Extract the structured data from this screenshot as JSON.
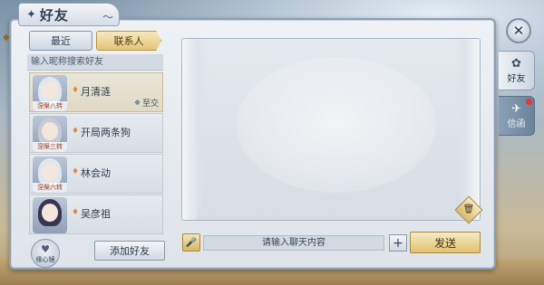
{
  "window": {
    "title": "好友",
    "title_icon": "friends-emblem-icon"
  },
  "tabs": {
    "recent": "最近",
    "contacts": "联系人"
  },
  "search": {
    "placeholder": "输入昵称搜索好友"
  },
  "friends": [
    {
      "name": "月清涟",
      "rank": "涅槃八转",
      "relation": "至交",
      "selected": true
    },
    {
      "name": "开局两条狗",
      "rank": "涅槃三转",
      "relation": "",
      "selected": false
    },
    {
      "name": "林会动",
      "rank": "涅槃六转",
      "relation": "",
      "selected": false
    },
    {
      "name": "吴彦祖",
      "rank": "",
      "relation": "",
      "selected": false
    }
  ],
  "actions": {
    "heart_label": "缘心镜",
    "add_friend": "添加好友"
  },
  "chat": {
    "input_placeholder": "请输入聊天内容",
    "send": "发送",
    "plus": "+"
  },
  "sidebar": {
    "friends_label": "好友",
    "mail_label": "信函",
    "mail_notification": true
  },
  "colors": {
    "accent_gold": "#e1c170",
    "panel_bg": "#e4e9ee",
    "frame_blue": "#8c9eb3",
    "notify_red": "#e23b2e"
  }
}
